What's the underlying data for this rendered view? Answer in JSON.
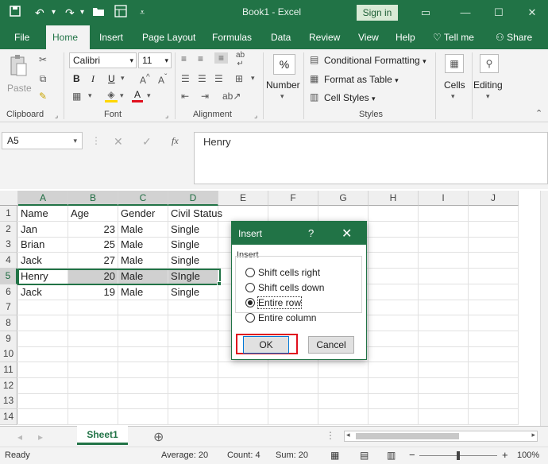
{
  "titlebar": {
    "title": "Book1  -  Excel",
    "signin": "Sign in",
    "save_icon": "save-icon",
    "undo_icon": "undo-icon",
    "redo_icon": "redo-icon",
    "open_icon": "folder-icon",
    "form_icon": "form-icon"
  },
  "tabs": {
    "file": "File",
    "home": "Home",
    "insert": "Insert",
    "page_layout": "Page Layout",
    "formulas": "Formulas",
    "data": "Data",
    "review": "Review",
    "view": "View",
    "help": "Help",
    "tellme": "Tell me",
    "share": "Share"
  },
  "ribbon": {
    "paste": "Paste",
    "font_name": "Calibri",
    "font_size": "11",
    "bold": "B",
    "italic": "I",
    "underline": "U",
    "number_icon": "%",
    "number": "Number",
    "conditional_formatting": "Conditional Formatting",
    "format_as_table": "Format as Table",
    "cell_styles": "Cell Styles",
    "cells": "Cells",
    "editing": "Editing",
    "groups": {
      "clipboard": "Clipboard",
      "font": "Font",
      "alignment": "Alignment",
      "styles": "Styles"
    }
  },
  "formula_bar": {
    "name_box": "A5",
    "fx": "fx",
    "value": "Henry"
  },
  "grid": {
    "columns": [
      "A",
      "B",
      "C",
      "D",
      "E",
      "F",
      "G",
      "H",
      "I",
      "J"
    ],
    "rows": [
      "1",
      "2",
      "3",
      "4",
      "5",
      "6",
      "7",
      "8",
      "9",
      "10",
      "11",
      "12",
      "13",
      "14"
    ],
    "data": [
      [
        "Name",
        "Age",
        "Gender",
        "Civil Status"
      ],
      [
        "Jan",
        "23",
        "Male",
        "Single"
      ],
      [
        "Brian",
        "25",
        "Male",
        "Single"
      ],
      [
        "Jack",
        "27",
        "Male",
        "Single"
      ],
      [
        "Henry",
        "20",
        "Male",
        "SIngle"
      ],
      [
        "Jack",
        "19",
        "Male",
        "Single"
      ]
    ]
  },
  "dialog": {
    "title": "Insert",
    "help": "?",
    "close": "✕",
    "group_label": "Insert",
    "options": [
      "Shift cells right",
      "Shift cells down",
      "Entire row",
      "Entire column"
    ],
    "selected_index": 2,
    "ok": "OK",
    "cancel": "Cancel"
  },
  "sheets": {
    "active": "Sheet1",
    "add": "⊕"
  },
  "status": {
    "ready": "Ready",
    "average": "Average: 20",
    "count": "Count: 4",
    "sum": "Sum: 20",
    "zoom": "100%"
  },
  "colors": {
    "accent": "#217346",
    "highlight": "#e0101e"
  }
}
